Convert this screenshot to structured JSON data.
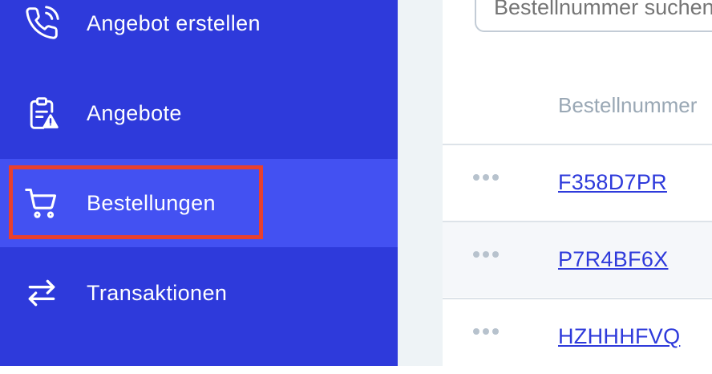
{
  "sidebar": {
    "items": [
      {
        "label": "Angebot erstellen",
        "icon": "phone-call-icon"
      },
      {
        "label": "Angebote",
        "icon": "clipboard-warning-icon"
      },
      {
        "label": "Bestellungen",
        "icon": "cart-icon",
        "active": true
      },
      {
        "label": "Transaktionen",
        "icon": "arrows-swap-icon"
      }
    ]
  },
  "search": {
    "placeholder": "Bestellnummer suchen"
  },
  "table": {
    "header": "Bestellnummer",
    "rows": [
      {
        "order_id": "F358D7PR"
      },
      {
        "order_id": "P7R4BF6X"
      },
      {
        "order_id": "HZHHHFVQ"
      }
    ]
  },
  "colors": {
    "sidebar_bg": "#2e3adb",
    "sidebar_active_bg": "#4351f2",
    "highlight_border": "#e8402f",
    "link": "#2e3adb"
  }
}
